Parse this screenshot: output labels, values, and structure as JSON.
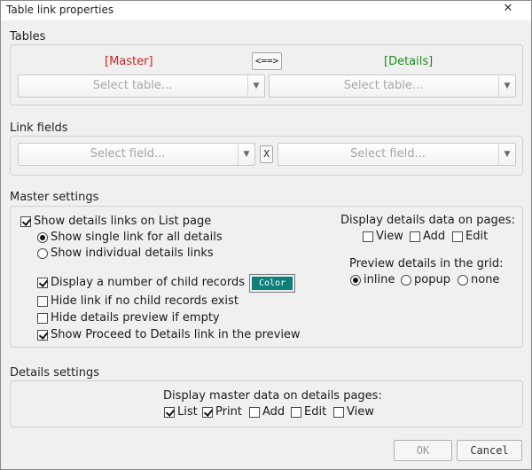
{
  "window": {
    "title": "Table link properties",
    "close_glyph": "✕"
  },
  "tables": {
    "section_label": "Tables",
    "master_label": "[Master]",
    "details_label": "[Details]",
    "link_button": "<==>",
    "master_select_placeholder": "Select table...",
    "details_select_placeholder": "Select table..."
  },
  "link_fields": {
    "section_label": "Link fields",
    "master_field_placeholder": "Select field...",
    "details_field_placeholder": "Select field...",
    "remove_button": "X"
  },
  "master_settings": {
    "section_label": "Master settings",
    "show_links": {
      "label": "Show details links on List page",
      "checked": true
    },
    "single_link": {
      "label": "Show single link for all details",
      "selected": true
    },
    "individual_links": {
      "label": "Show individual details links",
      "selected": false
    },
    "display_count": {
      "label": "Display a number of child records",
      "checked": true
    },
    "color_button": "Color",
    "hide_link": {
      "label": "Hide link if no child records exist",
      "checked": false
    },
    "hide_preview": {
      "label": "Hide details preview if empty",
      "checked": false
    },
    "show_proceed": {
      "label": "Show Proceed to Details link in the preview",
      "checked": true
    },
    "display_details_title": "Display details data on pages:",
    "pages": [
      {
        "label": "View",
        "checked": false
      },
      {
        "label": "Add",
        "checked": false
      },
      {
        "label": "Edit",
        "checked": false
      }
    ],
    "preview_title": "Preview details in the grid:",
    "preview_options": [
      {
        "label": "inline",
        "selected": true
      },
      {
        "label": "popup",
        "selected": false
      },
      {
        "label": "none",
        "selected": false
      }
    ]
  },
  "details_settings": {
    "section_label": "Details settings",
    "display_master_title": "Display master data on details pages:",
    "pages": [
      {
        "label": "List",
        "checked": true
      },
      {
        "label": "Print",
        "checked": true
      },
      {
        "label": "Add",
        "checked": false
      },
      {
        "label": "Edit",
        "checked": false
      },
      {
        "label": "View",
        "checked": false
      }
    ]
  },
  "buttons": {
    "ok": "OK",
    "cancel": "Cancel"
  },
  "colors": {
    "master": "#d02020",
    "details": "#1e8a1e",
    "color_swatch": "#0e7f7a"
  }
}
